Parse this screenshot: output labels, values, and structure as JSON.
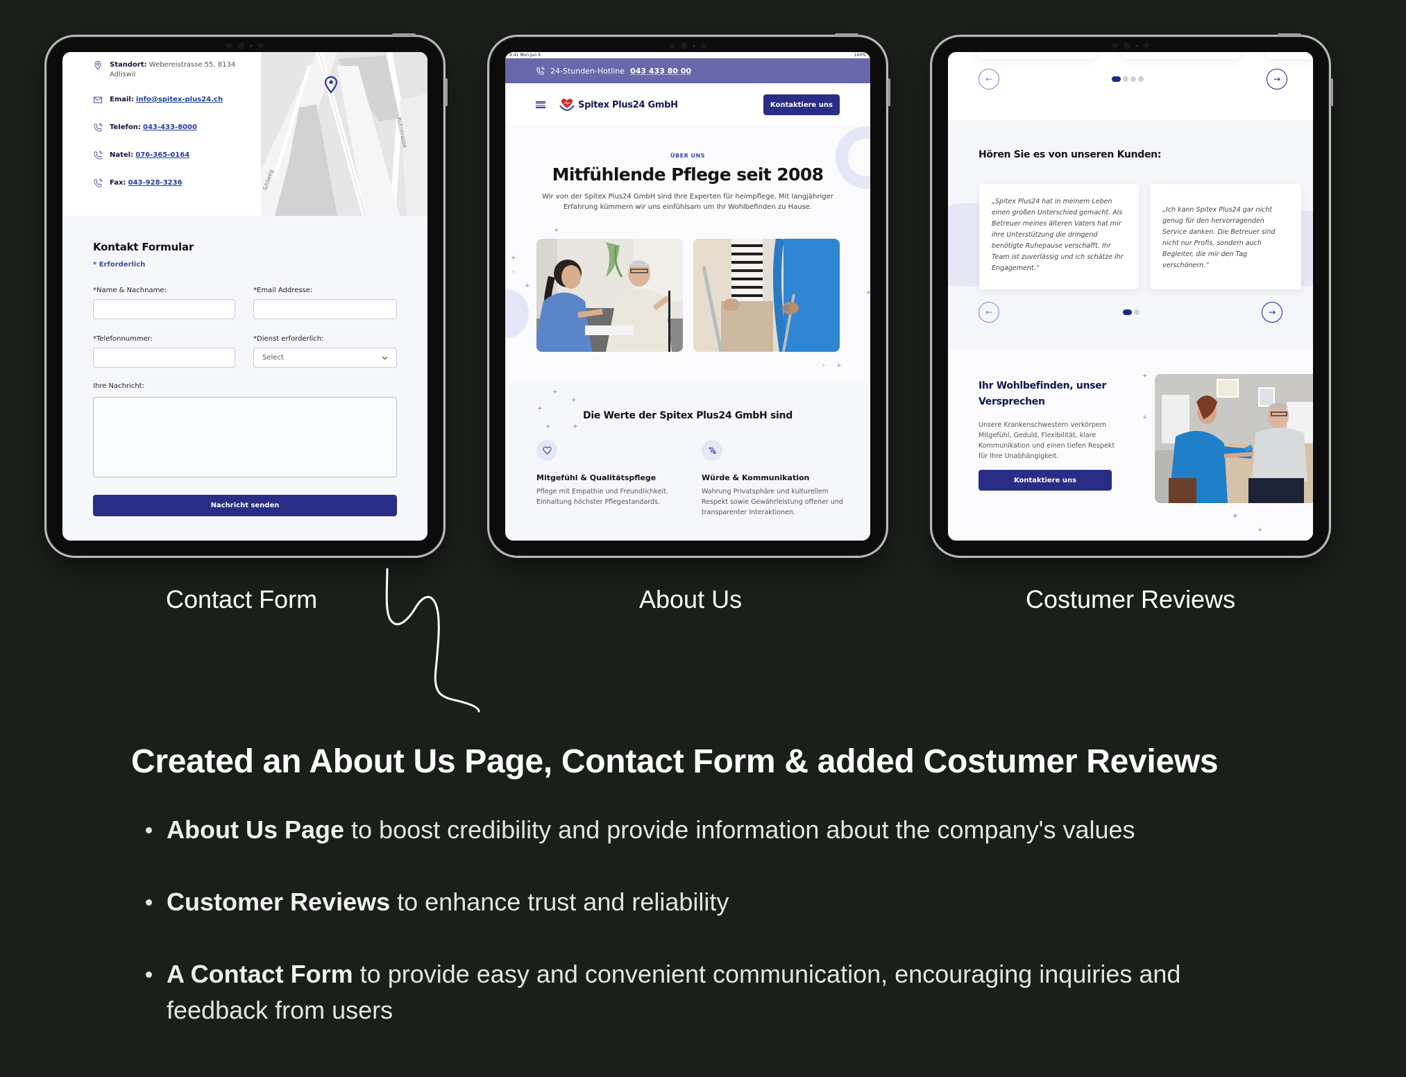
{
  "tablets": {
    "contact": {
      "info": {
        "location_label": "Standort:",
        "location_value": "Webereistrasse 55, 8134 Adliswil",
        "email_label": "Email:",
        "email_value": "info@spitex-plus24.ch",
        "phone_label": "Telefon:",
        "phone_value": "043-433-8000",
        "mobile_label": "Natel:",
        "mobile_value": "076-365-0164",
        "fax_label": "Fax:",
        "fax_value": "043-928-3236"
      },
      "map": {
        "street_1": "Sihlweg",
        "street_2": "Rütistrasse"
      },
      "form": {
        "title": "Kontakt Formular",
        "required_note": "* Erforderlich",
        "name_label": "*Name & Nachname:",
        "name_value": "",
        "email_label": "*Email Addresse:",
        "email_value": "",
        "phone_label": "*Telefonnummer:",
        "phone_value": "",
        "service_label": "*Dienst erforderlich:",
        "service_selected": "Select",
        "message_label": "Ihre Nachricht:",
        "message_value": "",
        "submit_label": "Nachricht senden"
      }
    },
    "about": {
      "statusbar": {
        "time": "9:41 Mon Jun 6",
        "battery": "100%"
      },
      "hotline": {
        "label": "24-Stunden-Hotline",
        "number": "043 433 80 00"
      },
      "nav": {
        "brand": "Spitex Plus24 GmbH",
        "cta": "Kontaktiere uns"
      },
      "hero": {
        "overline": "ÜBER UNS",
        "title": "Mitfühlende Pflege seit 2008",
        "lead": "Wir von der Spitex Plus24 GmbH sind Ihre Experten für heimpflege. Mit langjähriger Erfahrung kümmern wir uns einfühlsam um Ihr Wohlbefinden zu Hause."
      },
      "values": {
        "title": "Die Werte der Spitex Plus24 GmbH sind",
        "items": [
          {
            "icon": "heart-icon",
            "title": "Mitgefühl & Qualitätspflege",
            "text": "Pflege mit Empathie und Freundlichkeit. Einhaltung höchster Pflegestandards."
          },
          {
            "icon": "handshake-icon",
            "title": "Würde & Kommunikation",
            "text": "Wahrung Privatsphäre und kulturellem Respekt sowie Gewährleistung offener und transparenter Interaktionen."
          }
        ]
      }
    },
    "reviews": {
      "top_carousel": {
        "active_index": 0,
        "dot_count": 4
      },
      "section_title": "Hören Sie es von unseren Kunden:",
      "reviews": [
        {
          "text": "„Spitex Plus24 hat in meinem Leben einen großen Unterschied gemacht. Als Betreuer meines älteren Vaters hat mir ihre Unterstützung die dringend benötigte Ruhepause verschafft. Ihr Team ist zuverlässig und ich schätze ihr Engagement.“"
        },
        {
          "text": "„Ich kann Spitex Plus24 gar nicht genug für den hervorragenden Service danken. Die Betreuer sind nicht nur Profis, sondern auch Begleiter, die mir den Tag verschönern.“"
        }
      ],
      "review_carousel": {
        "active_index": 0,
        "dot_count": 2
      },
      "promise": {
        "title": "Ihr Wohlbefinden, unser Versprechen",
        "text": "Unsere Krankenschwestern verkörpern Mitgefühl, Geduld, Flexibilität, klare Kommunikation und einen tiefen Respekt für Ihre Unabhängigkeit.",
        "cta": "Kontaktiere uns"
      }
    }
  },
  "captions": {
    "contact": "Contact Form",
    "about": "About Us",
    "reviews": "Costumer Reviews"
  },
  "summary": {
    "title": "Created an About Us Page, Contact Form & added Costumer Reviews",
    "bullets": [
      {
        "bold": "About Us Page",
        "rest": " to boost credibility and provide information about the company's values"
      },
      {
        "bold": "Customer Reviews",
        "rest": " to enhance trust and reliability"
      },
      {
        "bold": "A Contact Form",
        "rest": " to provide easy and convenient communication, encouraging inquiries and feedback from users"
      }
    ]
  },
  "colors": {
    "background": "#1b1f1a",
    "brand_primary": "#2a2d86",
    "hotline_bar": "#6869ac",
    "accent_light": "#e5e6f6"
  }
}
